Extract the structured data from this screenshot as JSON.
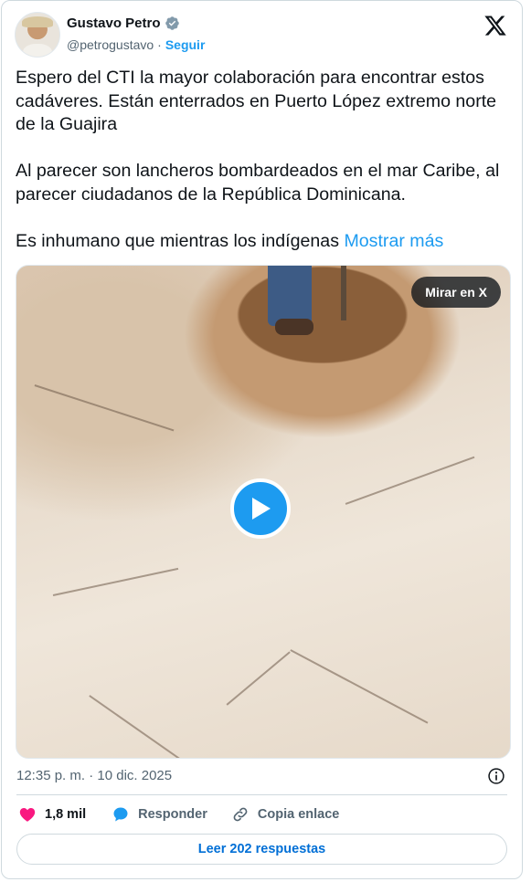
{
  "author": {
    "name": "Gustavo Petro",
    "handle": "@petrogustavo",
    "separator": "·",
    "follow_label": "Seguir",
    "verified_icon": "verified-badge-icon"
  },
  "platform_icon": "x-logo-icon",
  "tweet": {
    "paragraph_1": "Espero del CTI la mayor colaboración para encontrar estos cadáveres. Están enterrados en Puerto López extremo norte de la Guajira",
    "paragraph_2": "Al parecer son lancheros bombardeados en el mar Caribe, al parecer ciudadanos de la República Dominicana.",
    "paragraph_3": "Es inhumano que mientras los indígenas",
    "show_more": "Mostrar más"
  },
  "media": {
    "watch_label": "Mirar en X",
    "play_icon": "play-icon"
  },
  "timestamp": "12:35 p. m. · 10 dic. 2025",
  "actions": {
    "likes_count": "1,8 mil",
    "reply_label": "Responder",
    "copy_link_label": "Copia enlace"
  },
  "read_replies_label": "Leer 202 respuestas",
  "colors": {
    "accent": "#1d9bf0",
    "like": "#f91880",
    "text": "#0f1419",
    "muted": "#536471"
  }
}
